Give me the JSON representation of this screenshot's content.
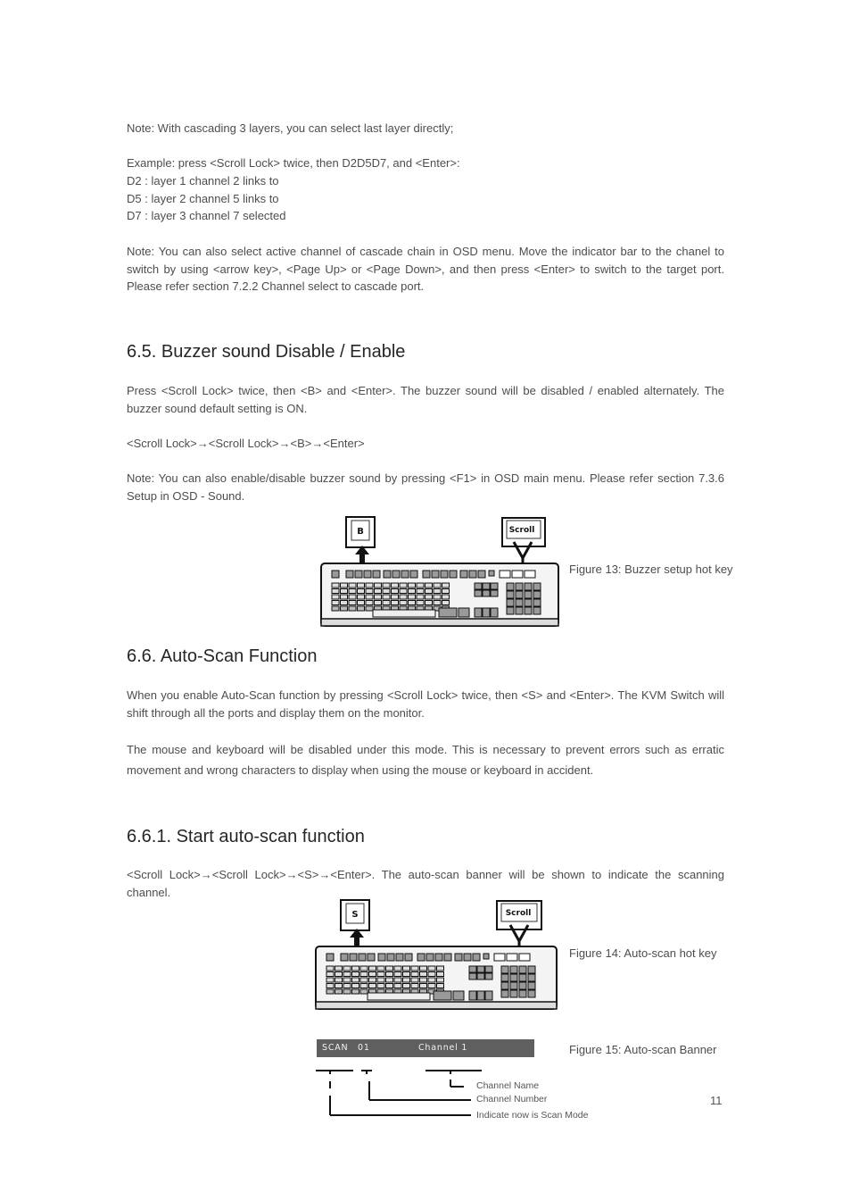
{
  "intro": {
    "note_cascade": "Note: With cascading 3 layers, you can select last layer directly;",
    "example": "Example:  press <Scroll Lock> twice, then D2D5D7, and <Enter>:",
    "lines": [
      "D2 : layer 1 channel 2 links to",
      "D5 : layer 2 channel 5 links to",
      "D7 : layer 3 channel 7 selected"
    ],
    "note_osd": "Note: You can also select active channel of cascade chain in OSD menu. Move the indicator bar to the chanel to switch by using <arrow key>, <Page Up> or <Page Down>, and then press <Enter> to switch to the target port. Please refer section 7.2.2 Channel select to cascade port."
  },
  "section_65": {
    "heading": "6.5. Buzzer sound Disable / Enable",
    "para1": "Press <Scroll Lock> twice, then <B> and <Enter>. The buzzer sound will be disabled / enabled alternately. The buzzer sound default setting is ON.",
    "sequence": "<Scroll Lock>→<Scroll Lock>→<B>→<Enter>",
    "note": "Note: You can also enable/disable buzzer sound by pressing <F1> in OSD main menu. Please refer section 7.3.6 Setup in OSD - Sound.",
    "figure": {
      "key_label": "B",
      "scroll_label": "Scroll",
      "caption": "Figure 13: Buzzer setup hot key"
    }
  },
  "section_66": {
    "heading": "6.6. Auto-Scan Function",
    "para1": "When you enable Auto-Scan function by pressing <Scroll Lock> twice, then <S> and <Enter>. The KVM Switch will shift through all the ports and display them on the monitor.",
    "para2": "The mouse and keyboard will be disabled under this mode. This is necessary to prevent errors such as erratic movement and wrong characters to display when using the mouse or keyboard in accident."
  },
  "section_661": {
    "heading": "6.6.1. Start auto-scan function",
    "para1": "<Scroll Lock>→<Scroll Lock>→<S>→<Enter>. The auto-scan banner will be shown to indicate the scanning channel.",
    "figure14": {
      "key_label": "S",
      "scroll_label": "Scroll",
      "caption": "Figure 14: Auto-scan hot key"
    },
    "figure15": {
      "banner_mode": "SCAN",
      "banner_number": "01",
      "banner_name": "Channel  1",
      "caption": "Figure 15: Auto-scan Banner",
      "labels": {
        "channel_name": "Channel Name",
        "channel_number": "Channel Number",
        "scan_mode": "Indicate now is Scan Mode"
      }
    }
  },
  "page_number": "11"
}
